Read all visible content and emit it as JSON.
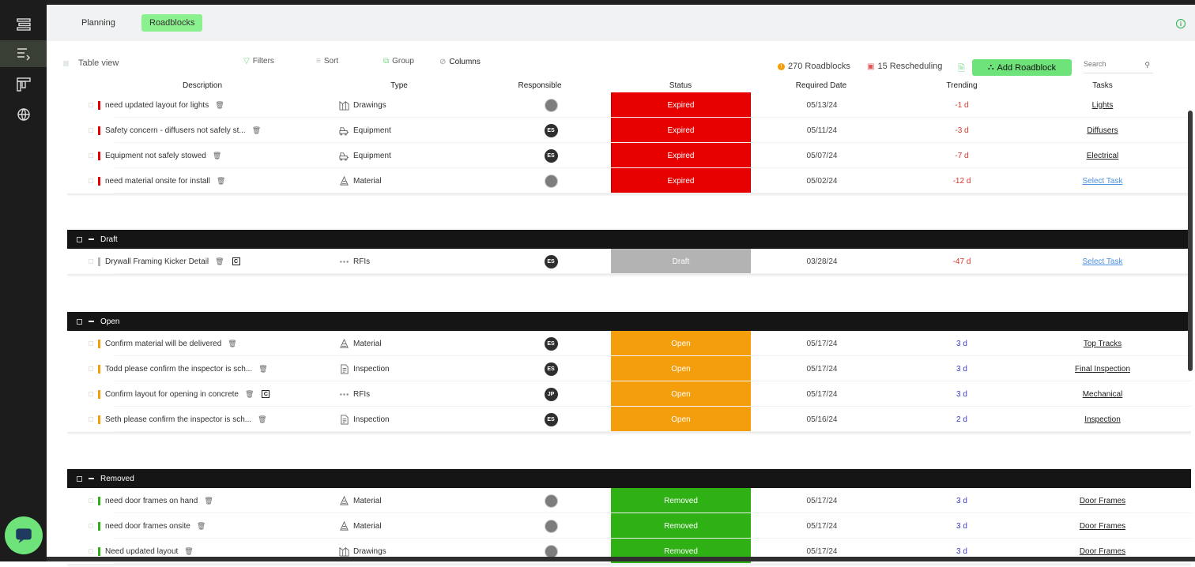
{
  "tabs": [
    {
      "label": "Planning",
      "active": false
    },
    {
      "label": "Roadblocks",
      "active": true
    }
  ],
  "toolbar": {
    "table_view": "Table view",
    "filters": "Filters",
    "sort": "Sort",
    "group": "Group",
    "columns": "Columns"
  },
  "summary": {
    "roadblocks": "270 Roadblocks",
    "rescheduling": "15 Rescheduling"
  },
  "add_button": "Add Roadblock",
  "search": {
    "placeholder": "Search"
  },
  "columns": [
    "Description",
    "Type",
    "Responsible",
    "Status",
    "Required Date",
    "Trending",
    "Tasks"
  ],
  "colors": {
    "expired": "#e60000",
    "draft": "#b3b3b3",
    "open": "#f59e0b",
    "removed": "#2fb015",
    "accent": "#6ee37a",
    "trend_negative": "#d9342b",
    "trend_positive": "#3b3bcc"
  },
  "groups": [
    {
      "title": "",
      "rows": [
        {
          "description": "need updated layout for lights",
          "type": "Drawings",
          "type_icon": "drawings-icon",
          "responsible": "",
          "responsible_photo": true,
          "status": "Expired",
          "date": "05/13/24",
          "trending": "-1 d",
          "task": "Lights"
        },
        {
          "description": "Safety concern - diffusers not safely st...",
          "type": "Equipment",
          "type_icon": "equipment-icon",
          "responsible": "ES",
          "status": "Expired",
          "date": "05/11/24",
          "trending": "-3 d",
          "task": "Diffusers"
        },
        {
          "description": "Equipment not safely stowed",
          "type": "Equipment",
          "type_icon": "equipment-icon",
          "responsible": "ES",
          "status": "Expired",
          "date": "05/07/24",
          "trending": "-7 d",
          "task": "Electrical"
        },
        {
          "description": "need material onsite for install",
          "type": "Material",
          "type_icon": "material-icon",
          "responsible": "",
          "responsible_photo": true,
          "status": "Expired",
          "date": "05/02/24",
          "trending": "-12 d",
          "task": "Select Task"
        }
      ]
    },
    {
      "title": "Draft",
      "rows": [
        {
          "description": "Drywall Framing Kicker Detail",
          "type": "RFIs",
          "type_icon": "rfi-icon",
          "responsible": "ES",
          "status": "Draft",
          "date": "03/28/24",
          "trending": "-47 d",
          "task": "Select Task",
          "c_badge": "C"
        }
      ]
    },
    {
      "title": "Open",
      "rows": [
        {
          "description": "Confirm material will be delivered",
          "type": "Material",
          "type_icon": "material-icon",
          "responsible": "ES",
          "status": "Open",
          "date": "05/17/24",
          "trending": "3 d",
          "task": "Top Tracks"
        },
        {
          "description": "Todd please confirm the inspector is sch...",
          "type": "Inspection",
          "type_icon": "inspection-icon",
          "responsible": "ES",
          "status": "Open",
          "date": "05/17/24",
          "trending": "3 d",
          "task": "Final Inspection"
        },
        {
          "description": "Confirm layout for opening in concrete",
          "type": "RFIs",
          "type_icon": "rfi-icon",
          "responsible": "JP",
          "status": "Open",
          "date": "05/17/24",
          "trending": "3 d",
          "task": "Mechanical",
          "c_badge": "C"
        },
        {
          "description": "Seth please confirm the inspector is sch...",
          "type": "Inspection",
          "type_icon": "inspection-icon",
          "responsible": "ES",
          "status": "Open",
          "date": "05/16/24",
          "trending": "2 d",
          "task": "Inspection"
        }
      ]
    },
    {
      "title": "Removed",
      "rows": [
        {
          "description": "need door frames on hand",
          "type": "Material",
          "type_icon": "material-icon",
          "responsible": "",
          "responsible_photo": true,
          "status": "Removed",
          "date": "05/17/24",
          "trending": "3 d",
          "task": "Door Frames"
        },
        {
          "description": "need door frames onsite",
          "type": "Material",
          "type_icon": "material-icon",
          "responsible": "",
          "responsible_photo": true,
          "status": "Removed",
          "date": "05/17/24",
          "trending": "3 d",
          "task": "Door Frames"
        },
        {
          "description": "Need updated layout",
          "type": "Drawings",
          "type_icon": "drawings-icon",
          "responsible": "",
          "responsible_photo": true,
          "status": "Removed",
          "date": "05/17/24",
          "trending": "3 d",
          "task": "Door Frames"
        }
      ]
    }
  ]
}
